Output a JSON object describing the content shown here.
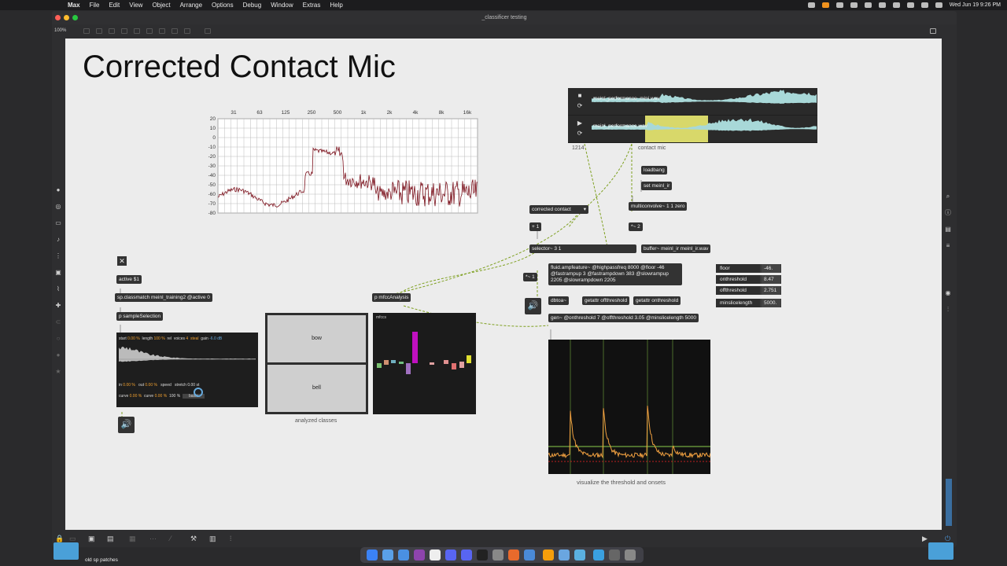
{
  "menubar": {
    "app": "Max",
    "items": [
      "File",
      "Edit",
      "View",
      "Object",
      "Arrange",
      "Options",
      "Debug",
      "Window",
      "Extras",
      "Help"
    ],
    "clock": "Wed Jun 19  9:26 PM"
  },
  "window": {
    "title": "_classificer testing",
    "zoom": "100%"
  },
  "patch": {
    "heading": "Corrected Contact Mic",
    "spectrum": {
      "freq_labels": [
        "31",
        "63",
        "125",
        "250",
        "500",
        "1k",
        "2k",
        "4k",
        "8k",
        "16k"
      ],
      "db_labels": [
        "20",
        "10",
        "0",
        "-10",
        "-20",
        "-30",
        "-40",
        "-50",
        "-60",
        "-70",
        "-80"
      ],
      "curve_color": "#7a0f1a"
    },
    "player": {
      "tracks": [
        {
          "file": "meinl_performance_mini.wav",
          "transport": "stop"
        },
        {
          "file": "meinl_performance.wav",
          "transport": "play"
        }
      ],
      "label_left": "1214",
      "label_right": "contact mic"
    },
    "objects": {
      "loadbang": "loadbang",
      "set_ir": "set meinl_ir",
      "multiconvolve": "multiconvolve~ 1 1 zero",
      "menu": "corrected contact",
      "plus1": "+ 1",
      "div2": "*~ 2",
      "selector": "selector~ 3 1",
      "buffer": "buffer~ meinl_ir meinl_ir.wav",
      "ampfeature": "fluid.ampfeature~ @highpassfreq 8000 @floor -46 @fastrampup 3 @fastrampdown 383 @slowrampup 2205 @slowrampdown 2205",
      "sig1": "*~ 1",
      "dbtoa": "dbtoa~",
      "getattr_off": "getattr offthreshold",
      "getattr_on": "getattr onthreshold",
      "gen": "gen~ @onthreshold 7 @offthreshold 3.05 @minslicelength 5000",
      "active": "active $1",
      "classmatch": "sp.classmatch meinl_training2 @active 0",
      "mfcc": "p mfccAnalysis",
      "sampleselection": "p sampleSelection"
    },
    "params": [
      {
        "name": "floor",
        "value": "-46."
      },
      {
        "name": "onthreshold",
        "value": "8.47"
      },
      {
        "name": "offthreshold",
        "value": "2.751"
      },
      {
        "name": "minslicelength",
        "value": "5000."
      }
    ],
    "classes": [
      "bow",
      "bell"
    ],
    "classes_caption": "analyzed classes",
    "mfcc_title": "mfccs",
    "sampler": {
      "start_label": "start",
      "start": "0.00 %",
      "length_label": "length",
      "length": "100 %",
      "rel_label": "rel",
      "voices_label": "voices",
      "voices": "4",
      "steal_label": "steal",
      "gain_label": "gain",
      "gain": "-6.0 dB",
      "in_label": "in",
      "in": "0.00 %",
      "out_label": "out",
      "out": "0.00 %",
      "speed_label": "speed",
      "speed": "100 %",
      "stretch_label": "stretch",
      "stretch": "0.00 st",
      "curve_label": "curve",
      "curve1": "0.00 %",
      "curve2": "0.00 %",
      "mode": "basic"
    },
    "onset_caption": "visualize the threshold and onsets"
  },
  "desktop": {
    "folder_label": "old sp patches"
  }
}
